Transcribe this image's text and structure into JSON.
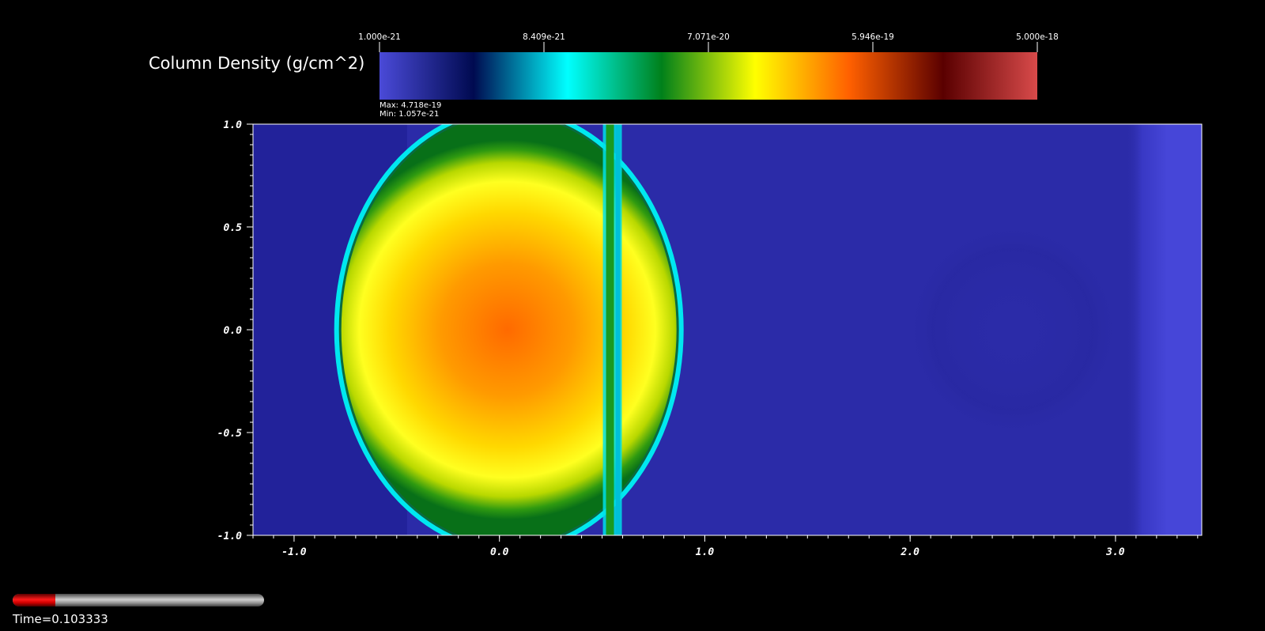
{
  "legend": {
    "title": "Column Density (g/cm^2)",
    "ticks": [
      "1.000e-21",
      "8.409e-21",
      "7.071e-20",
      "5.946e-19",
      "5.000e-18"
    ],
    "max_label": "Max:  4.718e-19",
    "min_label": "Min:  1.057e-21",
    "colormap": [
      "#4a4ad8",
      "#000a50",
      "#00ffff",
      "#00801a",
      "#ffff00",
      "#ff6000",
      "#5a0000",
      "#d84a4a"
    ]
  },
  "plot": {
    "x_ticks": [
      "-1.0",
      "0.0",
      "1.0",
      "2.0",
      "3.0"
    ],
    "y_ticks": [
      "1.0",
      "0.5",
      "0.0",
      "-0.5",
      "-1.0"
    ],
    "x_range": [
      -1.2,
      3.42
    ],
    "y_range": [
      -1.0,
      1.0
    ],
    "background_color": "#2b2ba8",
    "features": {
      "cloud_center": [
        0.0,
        0.0
      ],
      "shock_x": 0.55,
      "right_edge_band_x": 3.18
    }
  },
  "time_slider": {
    "label": "Time=0.103333",
    "progress": 0.17
  }
}
